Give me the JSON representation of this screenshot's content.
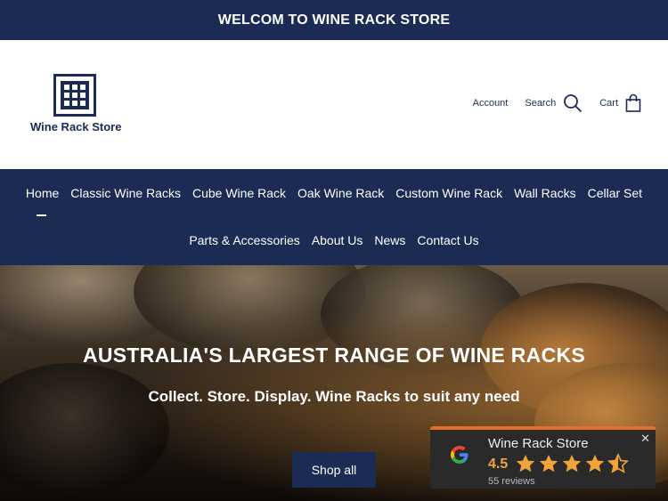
{
  "announcement": "WELCOM TO WINE RACK STORE",
  "logo": {
    "text": "Wine Rack Store"
  },
  "tools": {
    "account": "Account",
    "search": "Search",
    "cart": "Cart"
  },
  "nav": {
    "row1": [
      "Home",
      "Classic Wine Racks",
      "Cube Wine Rack",
      "Oak Wine Rack",
      "Custom Wine Rack",
      "Wall Racks",
      "Cellar Set"
    ],
    "row2": [
      "Parts & Accessories",
      "About Us",
      "News",
      "Contact Us"
    ]
  },
  "hero": {
    "title": "AUSTRALIA'S LARGEST RANGE OF WINE RACKS",
    "subtitle": "Collect. Store. Display. Wine Racks to suit any need",
    "button": "Shop all"
  },
  "review_widget": {
    "name": "Wine Rack Store",
    "score": "4.5",
    "rating": 4.5,
    "reviews": "55 reviews",
    "close": "✕"
  },
  "colors": {
    "navy": "#1b2b54",
    "star": "#f2a33a",
    "accent": "#e96b2b"
  }
}
